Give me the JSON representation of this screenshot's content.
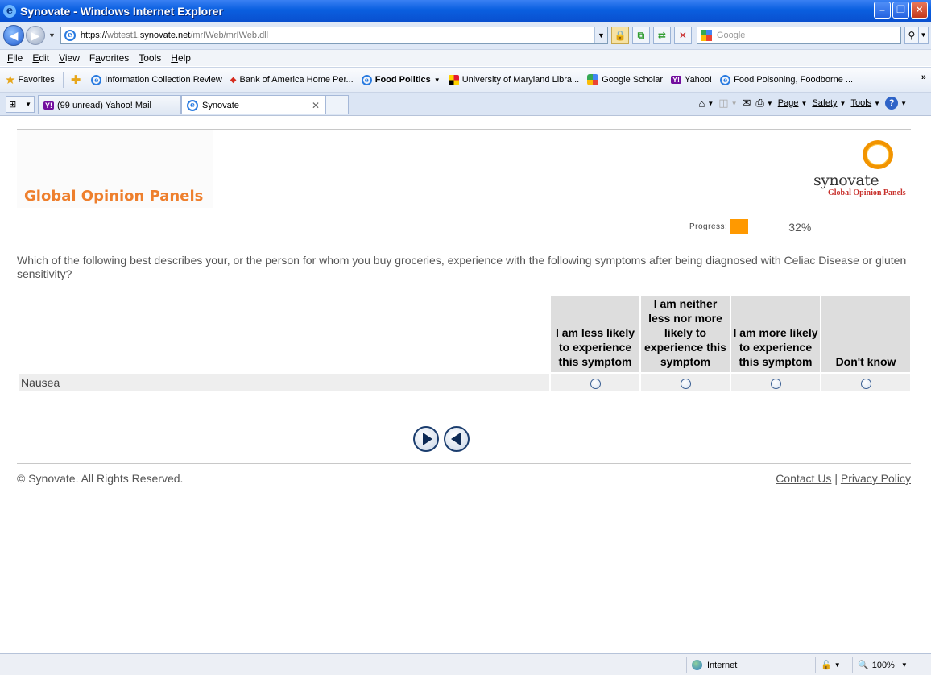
{
  "window": {
    "title": "Synovate - Windows Internet Explorer",
    "app_icon": "ie-icon"
  },
  "address": {
    "url_main": "https://",
    "url_host_dim": "wbtest1.",
    "url_host": "synovate.net",
    "url_path": "/mrIWeb/mrIWeb.dll",
    "search_placeholder": "Google"
  },
  "menu": [
    "File",
    "Edit",
    "View",
    "Favorites",
    "Tools",
    "Help"
  ],
  "menu_access_keys": [
    "F",
    "E",
    "V",
    "a",
    "T",
    "H"
  ],
  "favorites": {
    "label": "Favorites",
    "items": [
      {
        "label": "Information Collection Review",
        "icon": "ie-icon"
      },
      {
        "label": "Bank of America  Home  Per...",
        "icon": "boa-icon"
      },
      {
        "label": "Food Politics",
        "icon": "ie-icon",
        "bold": true
      },
      {
        "label": "University of Maryland Libra...",
        "icon": "umd-icon"
      },
      {
        "label": "Google Scholar",
        "icon": "gs-icon"
      },
      {
        "label": "Yahoo!",
        "icon": "yahoo-icon"
      },
      {
        "label": "Food Poisoning, Foodborne ...",
        "icon": "ie-icon"
      }
    ]
  },
  "tabs": [
    {
      "label": "(99 unread) Yahoo! Mail",
      "icon": "yahoo-icon"
    },
    {
      "label": "Synovate",
      "icon": "ie-icon",
      "active": true
    }
  ],
  "commands": [
    "Page",
    "Safety",
    "Tools"
  ],
  "page": {
    "brand_title": "Global Opinion Panels",
    "logo_word": "synovate",
    "logo_sub": "Global Opinion Panels",
    "progress_label": "Progress:",
    "progress_value": 0.32,
    "progress_text": "32%",
    "question": "Which of the following best describes your, or the person for whom you buy groceries, experience with the following symptoms after being diagnosed with Celiac Disease or gluten sensitivity?",
    "columns": [
      "I am less likely to experience this symptom",
      "I am neither less nor more likely to experience this symptom",
      "I am more likely to experience this symptom",
      "Don't know"
    ],
    "rows": [
      {
        "label": "Nausea"
      }
    ],
    "copyright": "© Synovate. All Rights Reserved.",
    "contact_link": "Contact Us",
    "separator": "|",
    "privacy_link": "Privacy Policy"
  },
  "status": {
    "zone": "Internet",
    "zoom": "100%"
  },
  "colors": {
    "brand_orange": "#ee7f2d",
    "progress": "#ff9900",
    "titlebar": "#0a5fe0"
  }
}
